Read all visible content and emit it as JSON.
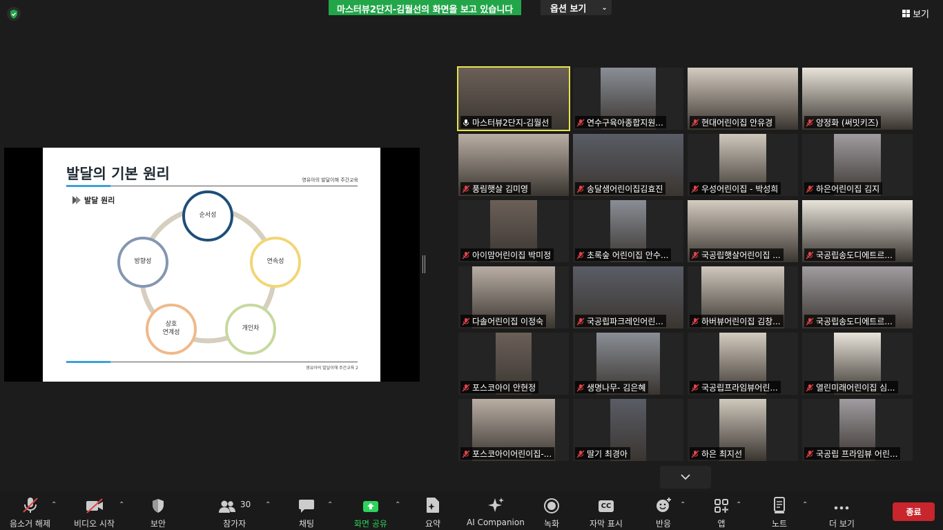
{
  "banner": {
    "text": "마스터뷰2단지-김월선의 화면을 보고 있습니다",
    "options_label": "옵션 보기",
    "view_label": "보기"
  },
  "slide": {
    "title": "발달의 기본 원리",
    "subtitle": "영유아의 발달이해 주간교육",
    "section": "발달 원리",
    "footer": "영유아의 발달이해 주간교육",
    "page": "2",
    "nodes": [
      {
        "label": "순서성",
        "color": "#1f4e79"
      },
      {
        "label": "연속성",
        "color": "#f2d675"
      },
      {
        "label": "개인차",
        "color": "#c6d99f"
      },
      {
        "label": "상호\n연계성",
        "color": "#f0b98a"
      },
      {
        "label": "방향성",
        "color": "#8496b0"
      }
    ]
  },
  "participants": [
    {
      "name": "마스터뷰2단지-김월선",
      "muted": false,
      "active": true
    },
    {
      "name": "연수구육아종합지원...",
      "muted": true
    },
    {
      "name": "현대어린이집 안유경",
      "muted": true
    },
    {
      "name": "양정화 (써밋키즈)",
      "muted": true
    },
    {
      "name": "풍림햇살 김미영",
      "muted": true
    },
    {
      "name": "송달샘어린이집김효진",
      "muted": true
    },
    {
      "name": "우성어린이집 - 박성희",
      "muted": true
    },
    {
      "name": "하은어린이집 김지",
      "muted": true
    },
    {
      "name": "아이맘어린이집 박미정",
      "muted": true
    },
    {
      "name": "초록숲 어린이집 안수...",
      "muted": true
    },
    {
      "name": "국공립햇살어린이집 ...",
      "muted": true
    },
    {
      "name": "국공립송도디에트르...",
      "muted": true
    },
    {
      "name": "다솔어린이집 이정숙",
      "muted": true
    },
    {
      "name": "국공립파크레인어린...",
      "muted": true
    },
    {
      "name": "하버뷰어린이집 김창...",
      "muted": true
    },
    {
      "name": "국공립송도디에트르...",
      "muted": true
    },
    {
      "name": "포스코아이 안현정",
      "muted": true
    },
    {
      "name": "생명나무- 김은혜",
      "muted": true
    },
    {
      "name": "국공립프라임뷰어린...",
      "muted": true
    },
    {
      "name": "열린미래어린이집 심...",
      "muted": true
    },
    {
      "name": "포스코아이어린이집-...",
      "muted": true
    },
    {
      "name": "딸기 최경아",
      "muted": true
    },
    {
      "name": "하은 최지선",
      "muted": true
    },
    {
      "name": "국공립 프라임뷰 어린...",
      "muted": true
    }
  ],
  "toolbar": {
    "unmute": "음소거 해제",
    "start_video": "비디오 시작",
    "security": "보안",
    "participants": "참가자",
    "participants_count": "30",
    "chat": "채팅",
    "share": "화면 공유",
    "summary": "요약",
    "ai": "AI Companion",
    "record": "녹화",
    "captions": "자막 표시",
    "captions_badge": "CC",
    "reactions": "반응",
    "apps": "앱",
    "notes": "노트",
    "more": "더 보기",
    "end": "종료"
  },
  "colors": {
    "share_banner": "#23a64a",
    "end_button": "#c8252c",
    "active_speaker": "#e6e64a",
    "mic_off": "#e0434a"
  }
}
